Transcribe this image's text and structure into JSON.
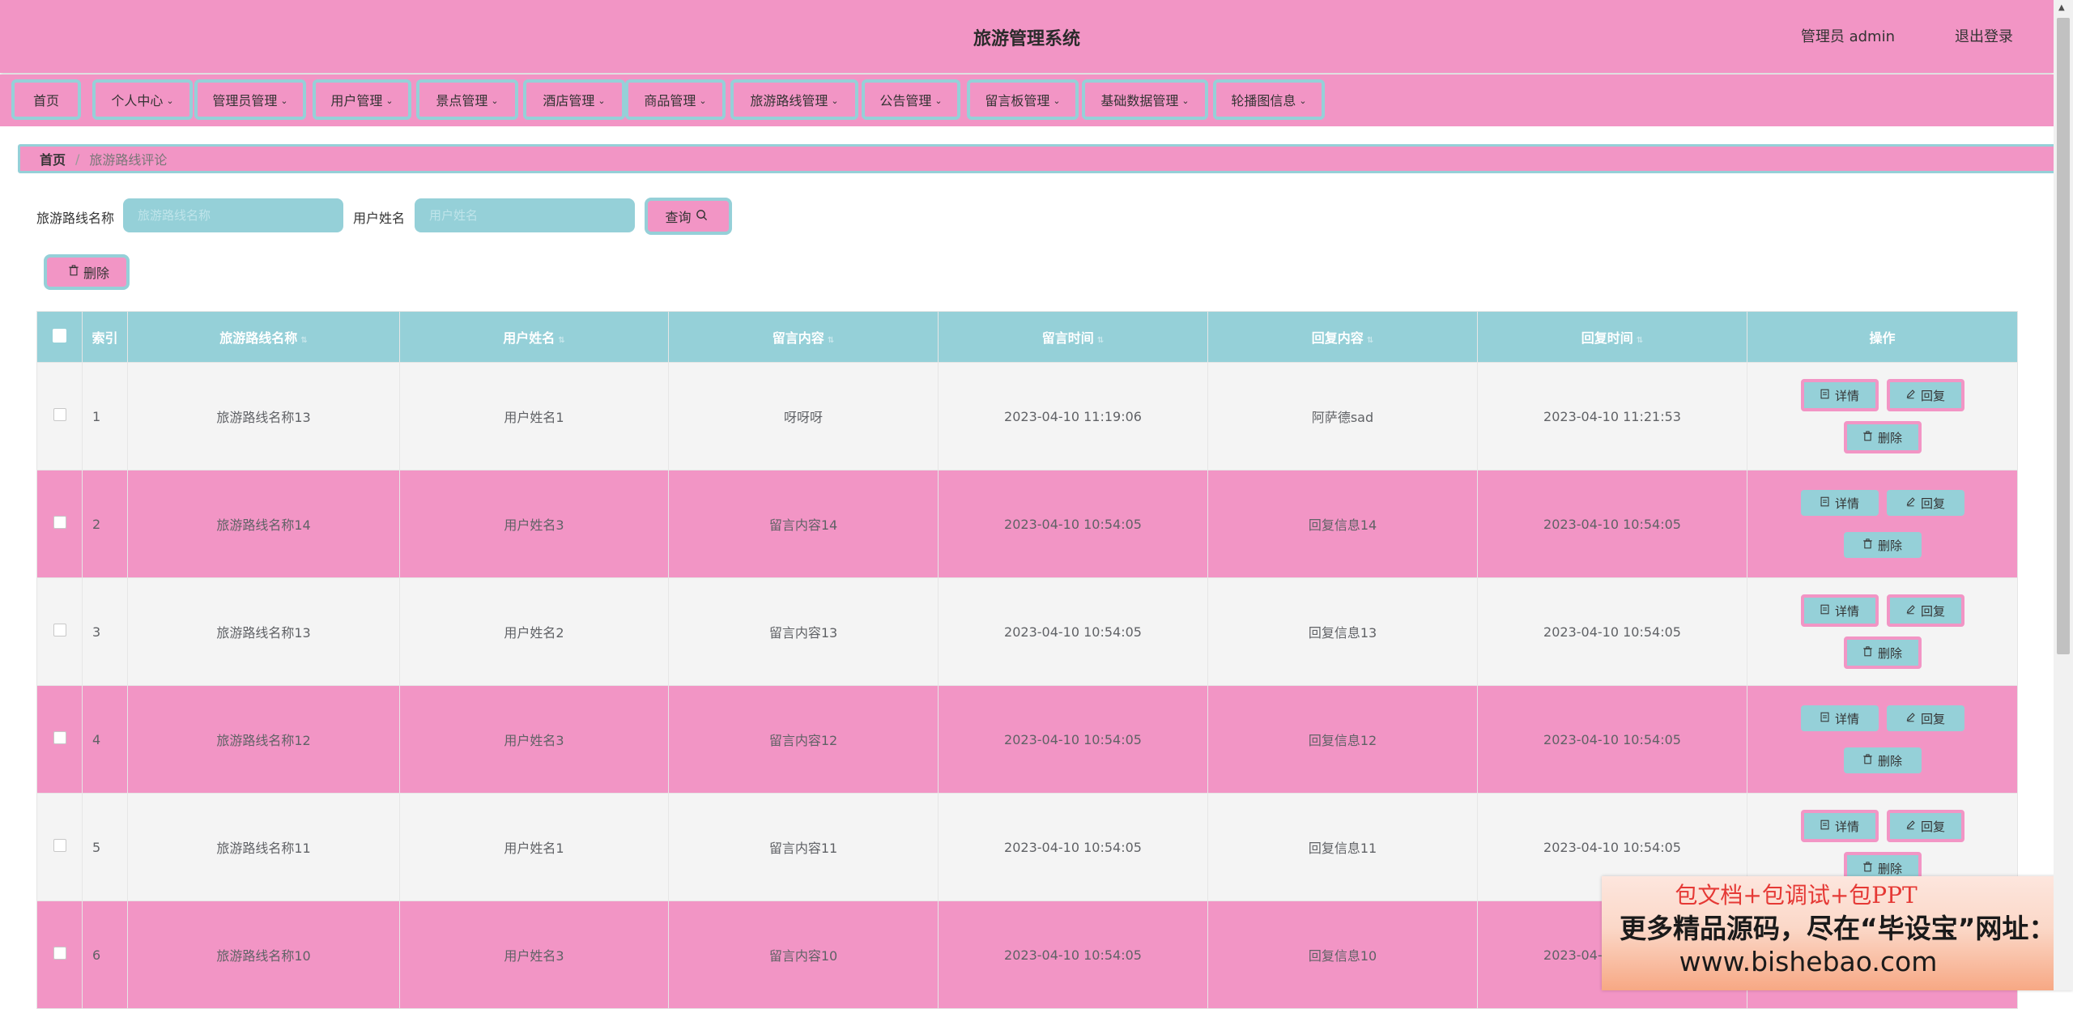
{
  "header": {
    "title": "旅游管理系统",
    "user": "管理员 admin",
    "logout": "退出登录"
  },
  "nav": [
    {
      "label": "首页",
      "dropdown": false
    },
    {
      "label": "个人中心",
      "dropdown": true
    },
    {
      "label": "管理员管理",
      "dropdown": true
    },
    {
      "label": "用户管理",
      "dropdown": true
    },
    {
      "label": "景点管理",
      "dropdown": true
    },
    {
      "label": "酒店管理",
      "dropdown": true
    },
    {
      "label": "商品管理",
      "dropdown": true
    },
    {
      "label": "旅游路线管理",
      "dropdown": true
    },
    {
      "label": "公告管理",
      "dropdown": true
    },
    {
      "label": "留言板管理",
      "dropdown": true
    },
    {
      "label": "基础数据管理",
      "dropdown": true
    },
    {
      "label": "轮播图信息",
      "dropdown": true
    }
  ],
  "breadcrumb": {
    "home": "首页",
    "separator": "/",
    "current": "旅游路线评论"
  },
  "search": {
    "route_label": "旅游路线名称",
    "route_placeholder": "旅游路线名称",
    "user_label": "用户姓名",
    "user_placeholder": "用户姓名",
    "query_button": "查询"
  },
  "batch_delete": "删除",
  "table": {
    "columns": [
      "索引",
      "旅游路线名称",
      "用户姓名",
      "留言内容",
      "留言时间",
      "回复内容",
      "回复时间",
      "操作"
    ],
    "rows": [
      {
        "index": "1",
        "route": "旅游路线名称13",
        "user": "用户姓名1",
        "content": "呀呀呀",
        "time": "2023-04-10 11:19:06",
        "reply": "阿萨德sad",
        "reply_time": "2023-04-10 11:21:53"
      },
      {
        "index": "2",
        "route": "旅游路线名称14",
        "user": "用户姓名3",
        "content": "留言内容14",
        "time": "2023-04-10 10:54:05",
        "reply": "回复信息14",
        "reply_time": "2023-04-10 10:54:05"
      },
      {
        "index": "3",
        "route": "旅游路线名称13",
        "user": "用户姓名2",
        "content": "留言内容13",
        "time": "2023-04-10 10:54:05",
        "reply": "回复信息13",
        "reply_time": "2023-04-10 10:54:05"
      },
      {
        "index": "4",
        "route": "旅游路线名称12",
        "user": "用户姓名3",
        "content": "留言内容12",
        "time": "2023-04-10 10:54:05",
        "reply": "回复信息12",
        "reply_time": "2023-04-10 10:54:05"
      },
      {
        "index": "5",
        "route": "旅游路线名称11",
        "user": "用户姓名1",
        "content": "留言内容11",
        "time": "2023-04-10 10:54:05",
        "reply": "回复信息11",
        "reply_time": "2023-04-10 10:54:05"
      },
      {
        "index": "6",
        "route": "旅游路线名称10",
        "user": "用户姓名3",
        "content": "留言内容10",
        "time": "2023-04-10 10:54:05",
        "reply": "回复信息10",
        "reply_time": "2023-04-10 10:54:05"
      }
    ],
    "actions": {
      "detail": "详情",
      "reply": "回复",
      "delete": "删除"
    }
  },
  "promo": {
    "line1": "包文档+包调试+包PPT",
    "line2": "更多精品源码，尽在“毕设宝”网址：",
    "line3": "www.bishebao.com"
  },
  "icons": {
    "search": "search-icon",
    "delete": "trash-icon",
    "detail": "document-icon",
    "reply": "edit-icon",
    "dropdown": "chevron-down-icon"
  },
  "colors": {
    "pink": "#f295c5",
    "teal": "#95d0d8",
    "row_gray": "#f4f4f4"
  }
}
